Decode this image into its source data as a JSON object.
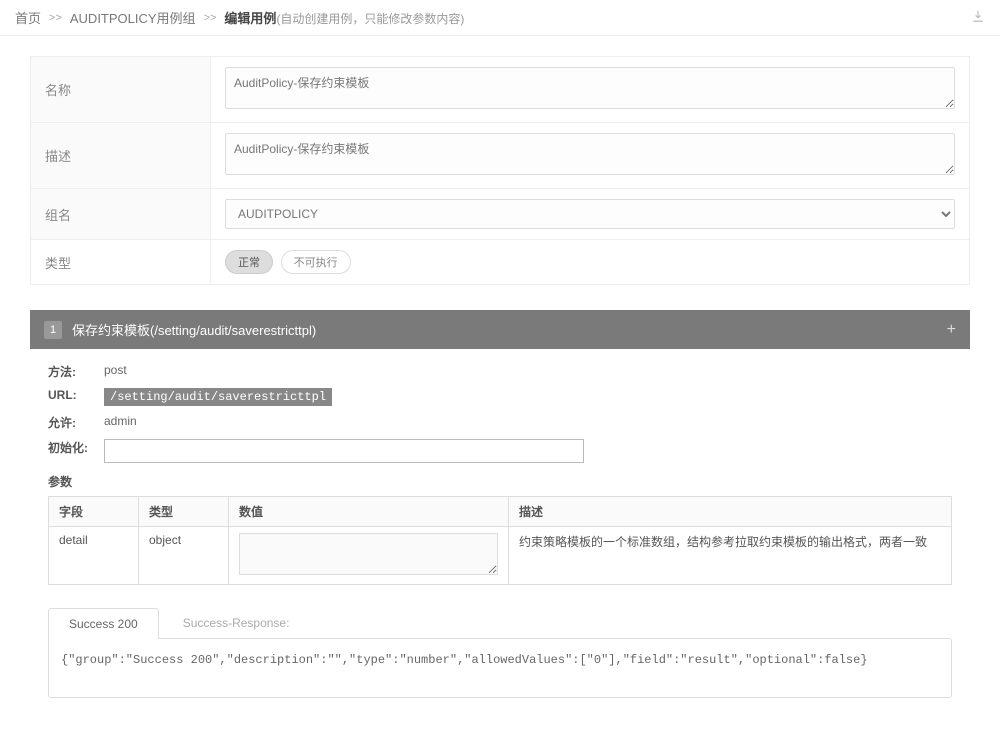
{
  "breadcrumb": {
    "home": "首页",
    "group": "AUDITPOLICY用例组",
    "current": "编辑用例",
    "hint": "(自动创建用例，只能修改参数内容)"
  },
  "form": {
    "name_label": "名称",
    "name_value": "AuditPolicy-保存约束模板",
    "desc_label": "描述",
    "desc_value": "AuditPolicy-保存约束模板",
    "group_label": "组名",
    "group_value": "AUDITPOLICY",
    "type_label": "类型",
    "type_opt1": "正常",
    "type_opt2": "不可执行"
  },
  "section": {
    "index": "1",
    "title": "保存约束模板(/setting/audit/saverestricttpl)"
  },
  "details": {
    "method_label": "方法:",
    "method_value": "post",
    "url_label": "URL:",
    "url_value": "/setting/audit/saverestricttpl",
    "allow_label": "允许:",
    "allow_value": "admin",
    "init_label": "初始化:",
    "params_label": "参数"
  },
  "param_headers": {
    "field": "字段",
    "type": "类型",
    "value": "数值",
    "desc": "描述"
  },
  "params": [
    {
      "field": "detail",
      "type": "object",
      "value": "",
      "desc": "约束策略模板的一个标准数组，结构参考拉取约束模板的输出格式，两者一致"
    }
  ],
  "response": {
    "tab": "Success 200",
    "label": "Success-Response:",
    "body": "{\"group\":\"Success 200\",\"description\":\"\",\"type\":\"number\",\"allowedValues\":[\"0\"],\"field\":\"result\",\"optional\":false}"
  }
}
